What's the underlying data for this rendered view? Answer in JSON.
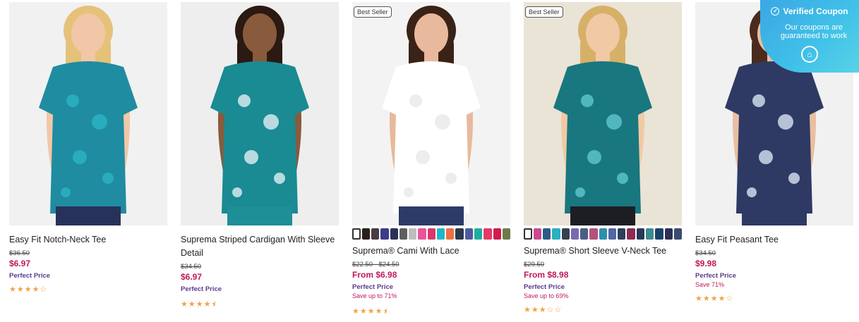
{
  "products": [
    {
      "name": "Easy Fit Notch-Neck Tee",
      "was": "$36.50",
      "now": "$6.97",
      "perfect": "Perfect Price",
      "save": "",
      "stars": "★★★★☆",
      "badge": "",
      "colors": {
        "bg": "#f1f1f1",
        "top": "#1f8ca1",
        "pattern": "#2ab4c6",
        "pants": "#26325a",
        "skin": "#f2c7a8",
        "hair": "#e5c27a"
      }
    },
    {
      "name": "Suprema Striped Cardigan With Sleeve Detail",
      "was": "$34.50",
      "now": "$6.97",
      "perfect": "Perfect Price",
      "save": "",
      "stars": "★★★★⯨",
      "badge": "",
      "colors": {
        "bg": "#eeeeee",
        "top": "#1a8a93",
        "pattern": "#dfeff1",
        "pants": "#1e8f97",
        "skin": "#8a5a3c",
        "hair": "#2a1a12"
      }
    },
    {
      "name": "Suprema® Cami With Lace",
      "was": "$22.50 - $24.50",
      "now": "From $6.98",
      "perfect": "Perfect Price",
      "save": "Save up to 71%",
      "stars": "★★★★⯨",
      "badge": "Best Seller",
      "swatches": [
        "#ffffff",
        "#2b1f1c",
        "#4a3b46",
        "#3d3c8a",
        "#2a2f5c",
        "#5e605d",
        "#bdbdbd",
        "#e9559a",
        "#d7396b",
        "#1fb6c9",
        "#ef6e44",
        "#2a3a4d",
        "#4e5aa0",
        "#1fae9e",
        "#e33b66",
        "#d01d4d",
        "#6f7a4a"
      ],
      "colors": {
        "bg": "#f3f3f3",
        "top": "#ffffff",
        "pattern": "#e8e8e8",
        "pants": "#2c3b67",
        "skin": "#e8b99c",
        "hair": "#3a2216"
      }
    },
    {
      "name": "Suprema® Short Sleeve V-Neck Tee",
      "was": "$29.50",
      "now": "From $8.98",
      "perfect": "Perfect Price",
      "save": "Save up to 69%",
      "stars": "★★★☆☆",
      "badge": "Best Seller",
      "swatches": [
        "#1c7f88",
        "#c94a8f",
        "#2e5c86",
        "#2bb1c0",
        "#36404f",
        "#7a6ab0",
        "#4b5f86",
        "#b6517d",
        "#2d8fb0",
        "#5167a6",
        "#2f3e5c",
        "#8e2c54",
        "#263a5a",
        "#3c8b8f",
        "#19436b",
        "#2d2f56",
        "#3a4a72"
      ],
      "colors": {
        "bg": "#e9e4d6",
        "top": "#19777f",
        "pattern": "#5fc7cf",
        "pants": "#1d1d24",
        "skin": "#f1c9a5",
        "hair": "#d7b068"
      }
    },
    {
      "name": "Easy Fit Peasant Tee",
      "was": "$34.50",
      "now": "$9.98",
      "perfect": "Perfect Price",
      "save": "Save 71%",
      "stars": "★★★★☆",
      "badge": "",
      "colors": {
        "bg": "#f1f1f1",
        "top": "#2e3a63",
        "pattern": "#d9e4f2",
        "pants": "#2e3a63",
        "skin": "#e9bfa0",
        "hair": "#4b2b1c"
      }
    }
  ],
  "coupon": {
    "title": "Verified Coupon",
    "subtitle": "Our coupons are guaranteed to work"
  }
}
